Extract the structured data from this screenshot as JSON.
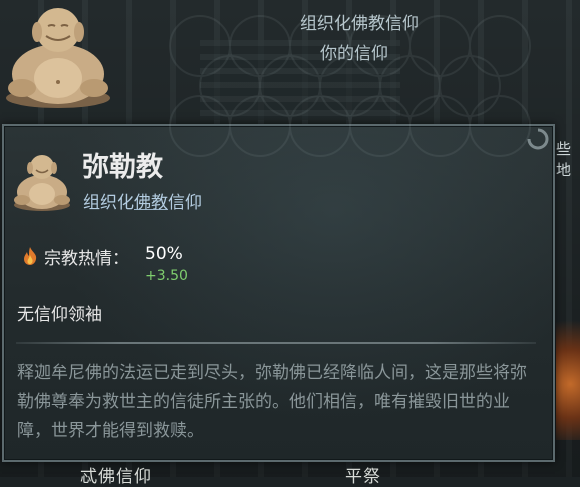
{
  "background": {
    "header_line1": "组织化佛教信仰",
    "header_line2": "你的信仰",
    "right_partial": "些地",
    "bottom_left_partial": "忒佛信仰",
    "bottom_right_partial": "平祭"
  },
  "tooltip": {
    "icon": "buddha-statue-icon",
    "title": "弥勒教",
    "subtitle_pre": "组织化",
    "subtitle_link": "佛教",
    "subtitle_post": "信仰",
    "fervor": {
      "icon": "fire-icon",
      "label": "宗教热情：",
      "value": "50%",
      "delta": "+3.50",
      "delta_color": "#7fce6e"
    },
    "leader_status": "无信仰领袖",
    "description": "释迦牟尼佛的法运已走到尽头，弥勒佛已经降临人间，这是那些将弥勒佛尊奉为救世主的信徒所主张的。他们相信，唯有摧毁旧世的业障，世界才能得到救赎。"
  },
  "colors": {
    "panel_border": "#5c6a6e",
    "subtitle_link": "#b3cce0",
    "description_text": "#8a9699"
  }
}
